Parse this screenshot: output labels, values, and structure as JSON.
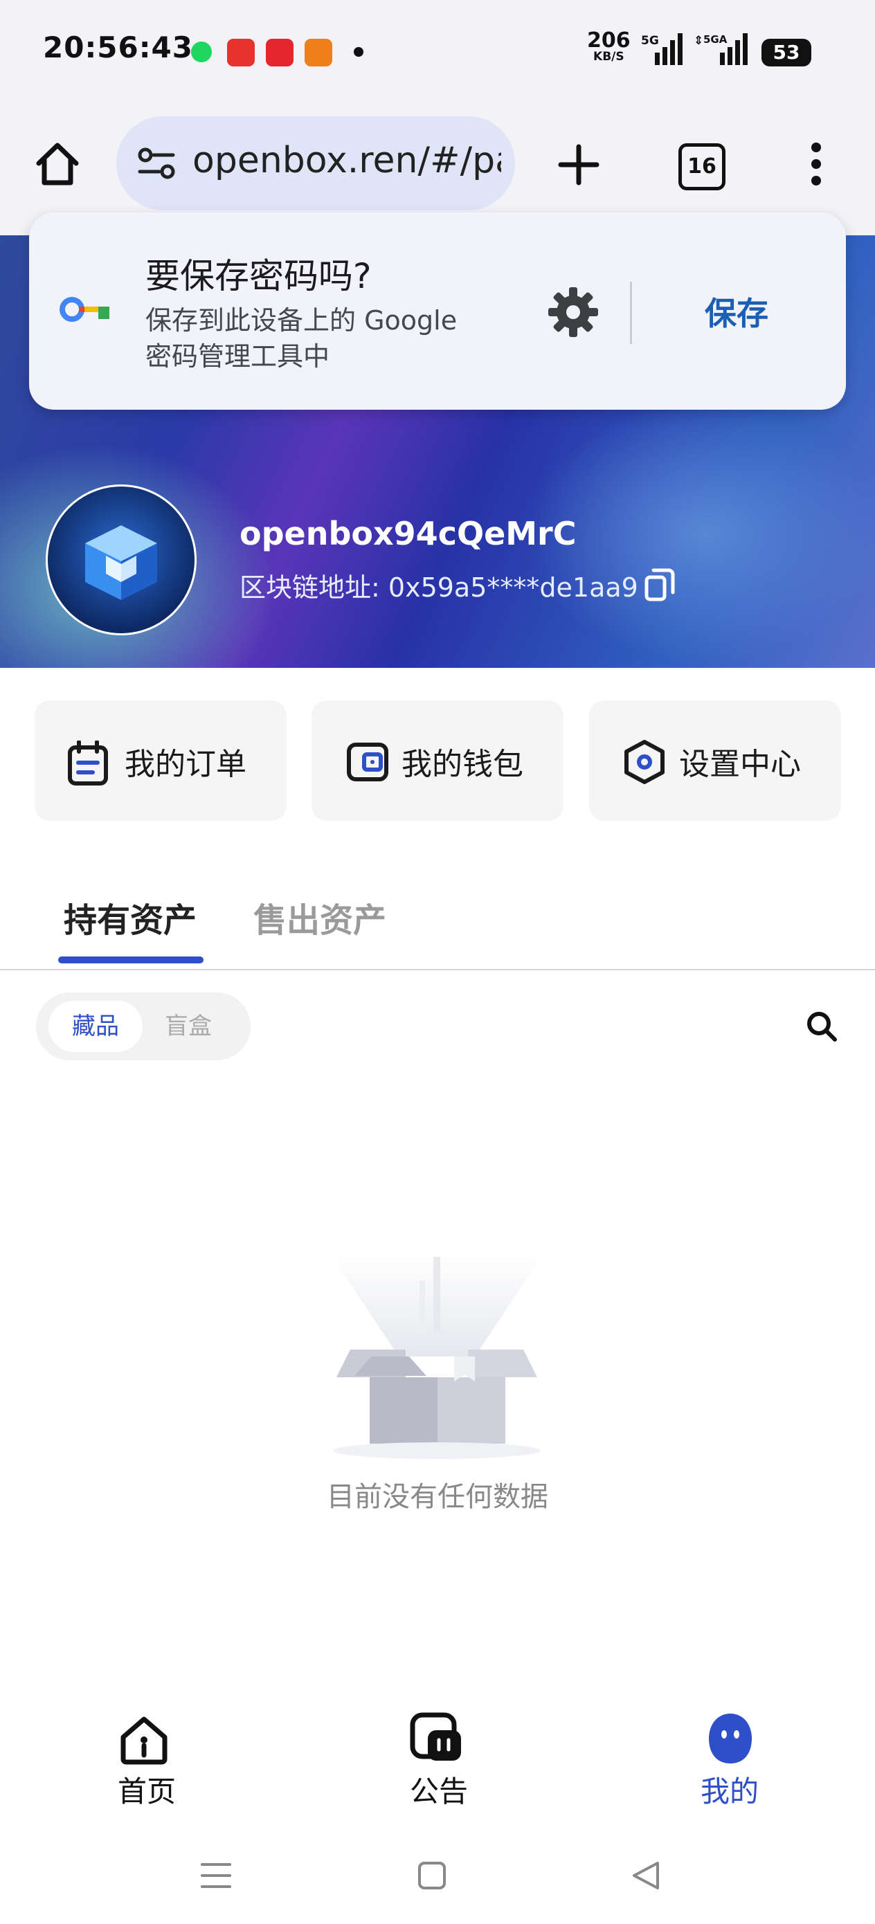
{
  "status_bar": {
    "time": "20:56:43",
    "network_speed": "206",
    "network_speed_unit": "KB/S",
    "signal1_label": "5G",
    "signal2_label": "5GA",
    "battery": "53"
  },
  "browser": {
    "url": "openbox.ren/#/pa",
    "tab_count": "16"
  },
  "password_prompt": {
    "title": "要保存密码吗?",
    "subtitle": "保存到此设备上的 Google 密码管理工具中",
    "save_label": "保存"
  },
  "profile": {
    "username": "openbox94cQeMrC",
    "chain_address_label": "区块链地址:",
    "chain_address": "0x59a5****de1aa9"
  },
  "quick_actions": {
    "orders": "我的订单",
    "wallet": "我的钱包",
    "settings": "设置中心"
  },
  "asset_tabs": {
    "held": "持有资产",
    "sold": "售出资产"
  },
  "filter": {
    "collectibles": "藏品",
    "blind_box": "盲盒"
  },
  "empty_state": {
    "message": "目前没有任何数据"
  },
  "bottom_nav": {
    "home": "首页",
    "announcements": "公告",
    "mine": "我的"
  },
  "colors": {
    "accent": "#2d4fc7",
    "save_button": "#1b5fb4"
  }
}
